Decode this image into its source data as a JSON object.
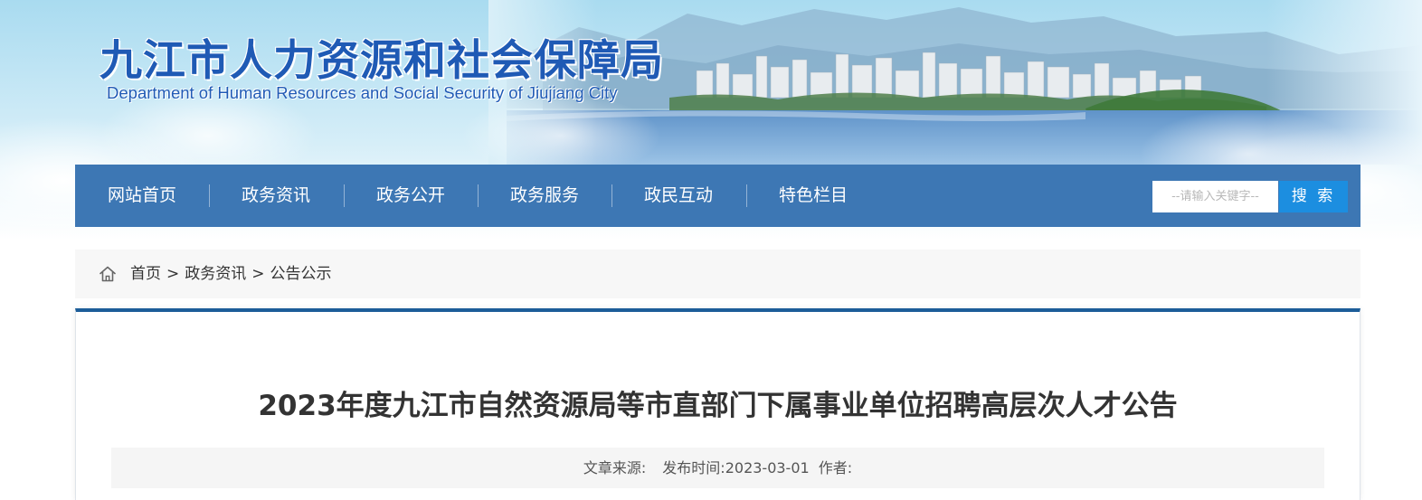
{
  "header": {
    "title": "九江市人力资源和社会保障局",
    "subtitle": "Department of Human Resources and Social Security of Jiujiang City"
  },
  "nav": {
    "items": [
      {
        "label": "网站首页"
      },
      {
        "label": "政务资讯"
      },
      {
        "label": "政务公开"
      },
      {
        "label": "政务服务"
      },
      {
        "label": "政民互动"
      },
      {
        "label": "特色栏目"
      }
    ]
  },
  "search": {
    "placeholder": "--请输入关键字--",
    "button_label": "搜 索"
  },
  "breadcrumb": {
    "items": [
      "首页",
      "政务资讯",
      "公告公示"
    ],
    "separator": ">"
  },
  "article": {
    "title": "2023年度九江市自然资源局等市直部门下属事业单位招聘高层次人才公告",
    "source_label": "文章来源:",
    "source_value": "",
    "date_label": "发布时间:",
    "date_value": "2023-03-01",
    "author_label": "作者:",
    "author_value": ""
  },
  "colors": {
    "nav_background": "#3d77b4",
    "search_button": "#1c8ee0",
    "title_blue": "#1f5ab5",
    "article_top_border": "#1c5d99"
  }
}
